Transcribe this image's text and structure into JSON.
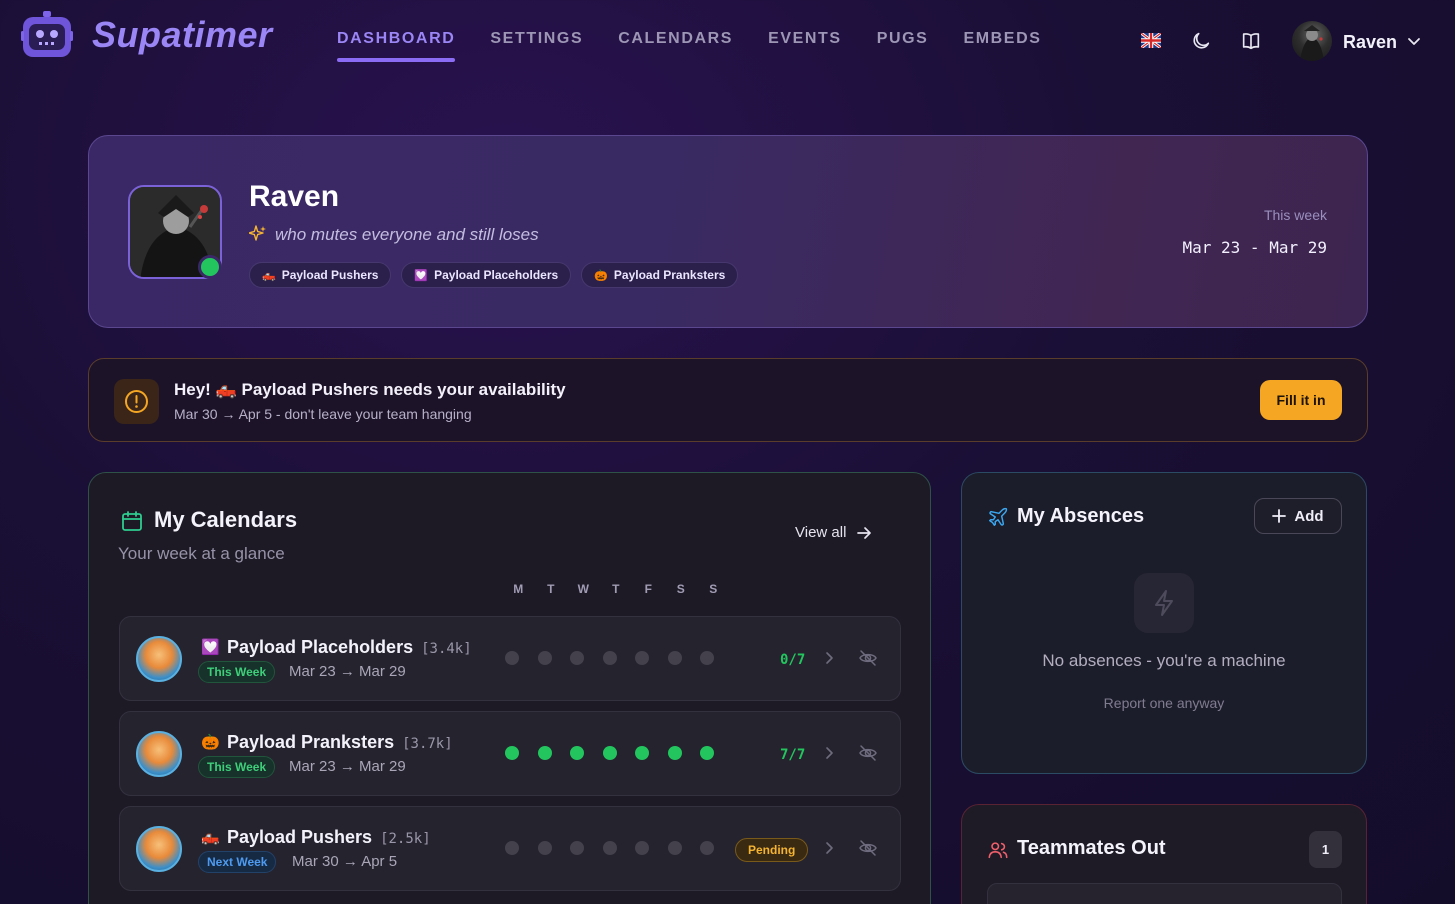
{
  "app": {
    "name": "Supatimer"
  },
  "nav": {
    "links": [
      {
        "label": "DASHBOARD",
        "active": true
      },
      {
        "label": "SETTINGS"
      },
      {
        "label": "CALENDARS"
      },
      {
        "label": "EVENTS"
      },
      {
        "label": "PUGS"
      },
      {
        "label": "EMBEDS"
      }
    ],
    "user_name": "Raven",
    "icons": [
      "uk-flag-icon",
      "moon-icon",
      "book-icon",
      "chevron-down-icon"
    ]
  },
  "profile": {
    "name": "Raven",
    "tagline": "who mutes everyone and still loses",
    "teams": [
      {
        "emoji": "🛻",
        "label": "Payload Pushers"
      },
      {
        "emoji": "💟",
        "label": "Payload Placeholders"
      },
      {
        "emoji": "🎃",
        "label": "Payload Pranksters"
      }
    ],
    "week_label": "This week",
    "week_range": "Mar 23 - Mar 29"
  },
  "alert": {
    "greeting": "Hey!",
    "emoji": "🛻",
    "team": "Payload Pushers",
    "message": "needs your availability",
    "subtitle": "Mar 30 → Apr 5 - don't leave your team hanging",
    "button": "Fill it in"
  },
  "calendars": {
    "title": "My Calendars",
    "subtitle": "Your week at a glance",
    "view_all": "View all",
    "days": [
      "M",
      "T",
      "W",
      "T",
      "F",
      "S",
      "S"
    ],
    "rows": [
      {
        "emoji": "💟",
        "name": "Payload Placeholders",
        "count": "[3.4k]",
        "badge": "This Week",
        "badge_color": "green",
        "dates": "Mar 23 → Mar 29",
        "days_filled": [
          false,
          false,
          false,
          false,
          false,
          false,
          false
        ],
        "score": "0/7"
      },
      {
        "emoji": "🎃",
        "name": "Payload Pranksters",
        "count": "[3.7k]",
        "badge": "This Week",
        "badge_color": "green",
        "dates": "Mar 23 → Mar 29",
        "days_filled": [
          true,
          true,
          true,
          true,
          true,
          true,
          true
        ],
        "score": "7/7"
      },
      {
        "emoji": "🛻",
        "name": "Payload Pushers",
        "count": "[2.5k]",
        "badge": "Next Week",
        "badge_color": "blue",
        "dates": "Mar 30 → Apr 5",
        "days_filled": [
          false,
          false,
          false,
          false,
          false,
          false,
          false
        ],
        "status": "Pending"
      }
    ]
  },
  "absences": {
    "title": "My Absences",
    "add_label": "Add",
    "empty_text": "No absences - you're a machine",
    "report_link": "Report one anyway"
  },
  "teammates": {
    "title": "Teammates Out",
    "count": "1"
  },
  "colors": {
    "accent": "#8b6cf5",
    "success": "#22c55e",
    "warning": "#f5a623",
    "info": "#4d9bf0"
  }
}
